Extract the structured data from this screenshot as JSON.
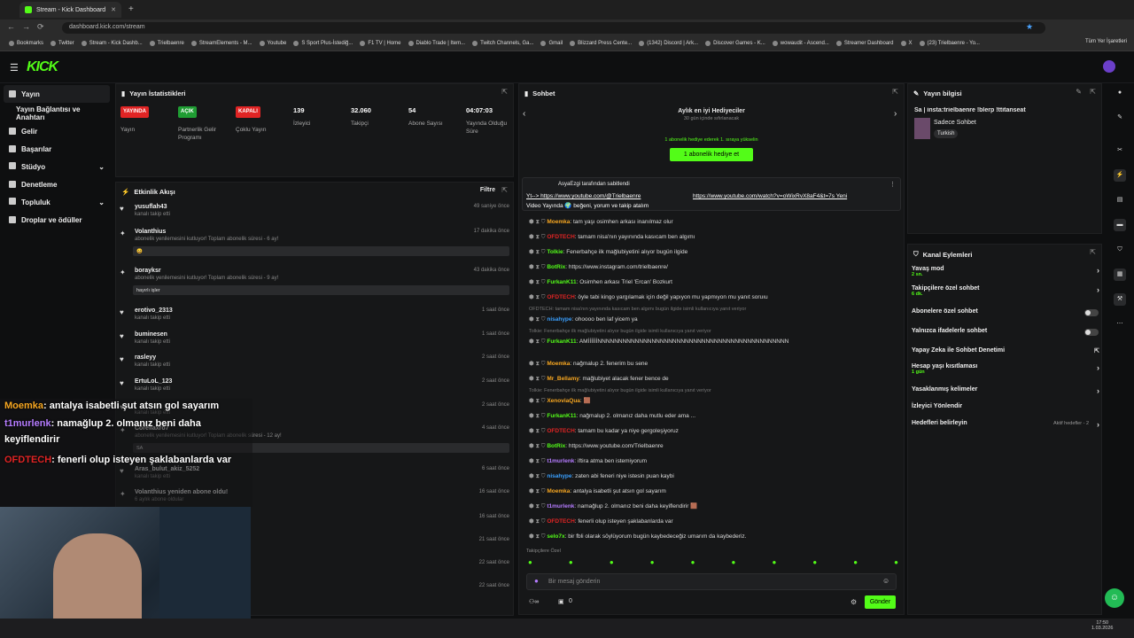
{
  "browser": {
    "tab_title": "Stream - Kick Dashboard",
    "url": "dashboard.kick.com/stream",
    "bookmarks": [
      "Bookmarks",
      "Twitter",
      "Stream - Kick Dashb...",
      "Trielbaenre",
      "StreamElements - M...",
      "Youtube",
      "S Sport Plus-İstediğ...",
      "F1 TV | Home",
      "Diablo Trade | Item...",
      "Twitch Channels, Ga...",
      "Gmail",
      "Blizzard Press Cente...",
      "(1342) Discord | Ark...",
      "Discover Games - K...",
      "wowaudit - Ascend...",
      "Streamer Dashboard",
      "X",
      "(23) Trielbaenre - Yo..."
    ],
    "all_bookmarks": "Tüm Yer İşaretleri"
  },
  "app": {
    "logo": "KICK"
  },
  "sidebar": {
    "items": [
      {
        "label": "Yayın"
      },
      {
        "label": "Yayın Bağlantısı ve Anahtarı"
      },
      {
        "label": "Gelir"
      },
      {
        "label": "Başarılar"
      },
      {
        "label": "Stüdyo"
      },
      {
        "label": "Denetleme"
      },
      {
        "label": "Topluluk"
      },
      {
        "label": "Droplar ve ödüller"
      }
    ]
  },
  "stats": {
    "title": "Yayın İstatistikleri",
    "items": [
      {
        "badge": "YAYINDA",
        "badge_color": "#e02424",
        "label": "Yayın"
      },
      {
        "badge": "AÇIK",
        "badge_color": "#1f9d33",
        "label": "Partnerlik Gelir Programı"
      },
      {
        "badge": "KAPALI",
        "badge_color": "#e02424",
        "label": "Çoklu Yayın"
      },
      {
        "value": "139",
        "label": "İzleyici"
      },
      {
        "value": "32.060",
        "label": "Takipçi"
      },
      {
        "value": "54",
        "label": "Abone Sayısı"
      },
      {
        "value": "04:07:03",
        "label": "Yayında Olduğu Süre"
      }
    ]
  },
  "activity": {
    "title": "Etkinlik Akışı",
    "filter": "Filtre",
    "items": [
      {
        "name": "yusuflah43",
        "sub": "kanalı takip etti",
        "time": "49 saniye önce",
        "icon": "heart-icon"
      },
      {
        "name": "Volanthius",
        "sub": "abonelik yenilemesini kutluyor! Toplam abonelik süresi - 6 ay!",
        "time": "17 dakika önce",
        "icon": "star-icon",
        "msg": "😀"
      },
      {
        "name": "borayksr",
        "sub": "abonelik yenilemesini kutluyor! Toplam abonelik süresi - 9 ay!",
        "time": "43 dakika önce",
        "icon": "star-icon",
        "msg": "hayırlı işler"
      },
      {
        "name": "erotivo_2313",
        "sub": "kanalı takip etti",
        "time": "1 saat önce",
        "icon": "heart-icon"
      },
      {
        "name": "buminesen",
        "sub": "kanalı takip etti",
        "time": "1 saat önce",
        "icon": "heart-icon"
      },
      {
        "name": "rasleyy",
        "sub": "kanalı takip etti",
        "time": "2 saat önce",
        "icon": "heart-icon"
      },
      {
        "name": "ErtuLoL_123",
        "sub": "kanalı takip etti",
        "time": "2 saat önce",
        "icon": "heart-icon"
      },
      {
        "name": "",
        "sub": "kanalı takip etti",
        "time": "2 saat önce",
        "icon": "heart-icon"
      },
      {
        "name": "Corellaxro7",
        "sub": "abonelik yenilemesini kutluyor! Toplam abonelik süresi - 12 ay!",
        "time": "4 saat önce",
        "icon": "star-icon",
        "msg": "SA"
      },
      {
        "name": "Aras_bulut_akiz_5252",
        "sub": "kanalı takip etti",
        "time": "6 saat önce",
        "icon": "heart-icon"
      },
      {
        "name": "Volanthius yeniden abone oldu!",
        "sub": "6 aylık abone oldular",
        "time": "16 saat önce",
        "icon": "star-icon"
      },
      {
        "name": "",
        "sub": "",
        "time": "16 saat önce",
        "icon": ""
      },
      {
        "name": "",
        "sub": "",
        "time": "21 saat önce",
        "icon": ""
      },
      {
        "name": "",
        "sub": "",
        "time": "22 saat önce",
        "icon": ""
      },
      {
        "name": "",
        "sub": "",
        "time": "22 saat önce",
        "icon": ""
      }
    ]
  },
  "chat": {
    "title": "Sohbet",
    "gifter_title": "Aylık en iyi Hediyeciler",
    "gifter_sub": "30 gün içinde sıfırlanacak",
    "gift_note": "1 abonelik hediye ederek 1. sıraya yükselin",
    "gift_button": "1 abonelik hediye et",
    "pinned_by": "AsyaEzgi tarafından sabitlendi",
    "pinned_text_1": "Yt--> https://www.youtube.com/@Trielbaenre",
    "pinned_text_2": "https://www.youtube.com/watch?v=oWixRvX8aF4&t=7s Yeni",
    "pinned_text_3": "Video Yayında 🌍 beğeni, yorum ve takip atalım",
    "messages": [
      {
        "user": "Moemka",
        "color": "#f7a721",
        "text": ": tam yaşı osimhen arkası inanılmaz olur",
        "type": "msg"
      },
      {
        "user": "OFDTECH",
        "color": "#e02424",
        "text": ": tamam nisa'nın yayınında kasıcam ben algımı",
        "type": "msg"
      },
      {
        "user": "Tolkie",
        "color": "#53fc18",
        "text": ": Fenerbahçe ilk mağlubiyetini alıyor bugün ilgide",
        "type": "msg"
      },
      {
        "user": "BotRix",
        "color": "#53fc18",
        "text": ": https://www.instagram.com/trielbaenre/",
        "type": "msg"
      },
      {
        "user": "FurkanK11",
        "color": "#53fc18",
        "text": ": Osimhen arkası Triel 'Ercan' Bozkurt",
        "type": "msg"
      },
      {
        "user": "OFDTECH",
        "color": "#e02424",
        "text": ": öyle tabi kingo yargılamak için değil yapıyon mu yapmıyon mu yanıt soruıu",
        "type": "msg"
      },
      {
        "user": "",
        "color": "#777",
        "text": "OFDTECH: tamam nisa'nın yayınında kasıcam ben algımı bugün ilgide isimli kullanıcıya yanıt veriyor",
        "type": "reply"
      },
      {
        "user": "nisahype",
        "color": "#3aa0ff",
        "text": ": ohoooo ben laf yicem ya",
        "type": "msg"
      },
      {
        "user": "",
        "color": "#777",
        "text": "Tolkie: Fenerbahçe ilk mağlubiyetini alıyor bugün ilgide isimli kullanıcıya yanıt veriyor",
        "type": "reply"
      },
      {
        "user": "FurkanK11",
        "color": "#53fc18",
        "text": ": AMİİİİİİNNNNNNNNNNNNNNNNNNNNNNNNNNNNNNNNNNNNNNNNNNNNNN",
        "type": "msg"
      },
      {
        "user": "Moemka",
        "color": "#f7a721",
        "text": ": nağmalup 2. fenerim bu sene",
        "type": "msg"
      },
      {
        "user": "Mr_Bellamy",
        "color": "#f7a721",
        "text": ": mağlubiyet alacak fener bence de",
        "type": "msg"
      },
      {
        "user": "",
        "color": "#777",
        "text": "Tolkie: Fenerbahçe ilk mağlubiyetini alıyor bugün ilgide isimli kullanıcıya yanıt veriyor",
        "type": "reply"
      },
      {
        "user": "XenoviaQua",
        "color": "#f7a721",
        "text": ": 🟫",
        "type": "msg"
      },
      {
        "user": "FurkanK11",
        "color": "#53fc18",
        "text": ": nağmalup 2. olmanız daha mutlu eder ama ...",
        "type": "msg"
      },
      {
        "user": "OFDTECH",
        "color": "#e02424",
        "text": ": tamam bu kadar ya niye gergoleşiyoruz",
        "type": "msg"
      },
      {
        "user": "BotRix",
        "color": "#53fc18",
        "text": ": https://www.youtube.com/Trielbaenre",
        "type": "msg"
      },
      {
        "user": "t1murlenk",
        "color": "#b57cff",
        "text": ": iftira atma ben istemiyorum",
        "type": "msg"
      },
      {
        "user": "nisahype",
        "color": "#3aa0ff",
        "text": ": zaten abi feneri niye istesin puan kaybi",
        "type": "msg"
      },
      {
        "user": "Moemka",
        "color": "#f7a721",
        "text": ": antalya isabetli şut atsın gol sayarım",
        "type": "msg"
      },
      {
        "user": "t1murlenk",
        "color": "#b57cff",
        "text": ": namağlup 2. olmanız beni daha keyiflendirir 🟫",
        "type": "msg"
      },
      {
        "user": "OFDTECH",
        "color": "#e02424",
        "text": ": fenerli olup isteyen şaklabanlarda var",
        "type": "msg"
      },
      {
        "user": "selo7x",
        "color": "#53fc18",
        "text": ": bir fbli olarak söylüyorum bugün kaybedeceğiz umarım da kaybederiz.",
        "type": "msg"
      }
    ],
    "followers_only": "Takipçilere Özel",
    "input_placeholder": "Bir mesaj gönderin",
    "count": "0",
    "send": "Gönder"
  },
  "stream_info": {
    "title": "Yayın bilgisi",
    "stream_title": "Sa | insta:trielbaenre !blerp !ttitanseat",
    "category": "Sadece Sohbet",
    "tag": "Turkish"
  },
  "channel_actions": {
    "title": "Kanal Eylemleri",
    "items": [
      {
        "label": "Yavaş mod",
        "sub": "2 sn.",
        "control": "chevron"
      },
      {
        "label": "Takipçilere özel sohbet",
        "sub": "6 dk.",
        "control": "chevron"
      },
      {
        "label": "Abonelere özel sohbet",
        "sub": "",
        "control": "switch"
      },
      {
        "label": "Yalnızca ifadelerle sohbet",
        "sub": "",
        "control": "switch"
      },
      {
        "label": "Yapay Zeka ile Sohbet Denetimi",
        "sub": "",
        "control": "external"
      },
      {
        "label": "Hesap yaşı kısıtlaması",
        "sub": "1 gün",
        "control": "chevron"
      },
      {
        "label": "Yasaklanmış kelimeler",
        "sub": "",
        "control": "chevron"
      },
      {
        "label": "İzleyici Yönlendir",
        "sub": "",
        "control": "none"
      },
      {
        "label": "Hedefleri belirleyin",
        "sub": "",
        "control": "chevron",
        "extra": "Aktif hedefler - 2"
      }
    ]
  },
  "overlay": {
    "lines": [
      {
        "user": "Moemka",
        "color": "#f7a721",
        "text": ": antalya isabetli şut atsın gol sayarım"
      },
      {
        "user": "t1murlenk",
        "color": "#b57cff",
        "text": ": namağlup 2. olmanız beni daha"
      },
      {
        "user": "",
        "color": "#fff",
        "text": "keyiflendirir"
      },
      {
        "user": "OFDTECH",
        "color": "#e02424",
        "text": ": fenerli olup isteyen şaklabanlarda var"
      }
    ]
  },
  "taskbar": {
    "time": "17:50",
    "date": "1.03.2026"
  },
  "colors": {
    "accent": "#53fc18",
    "panel": "#161718",
    "bg": "#0e0f10"
  }
}
